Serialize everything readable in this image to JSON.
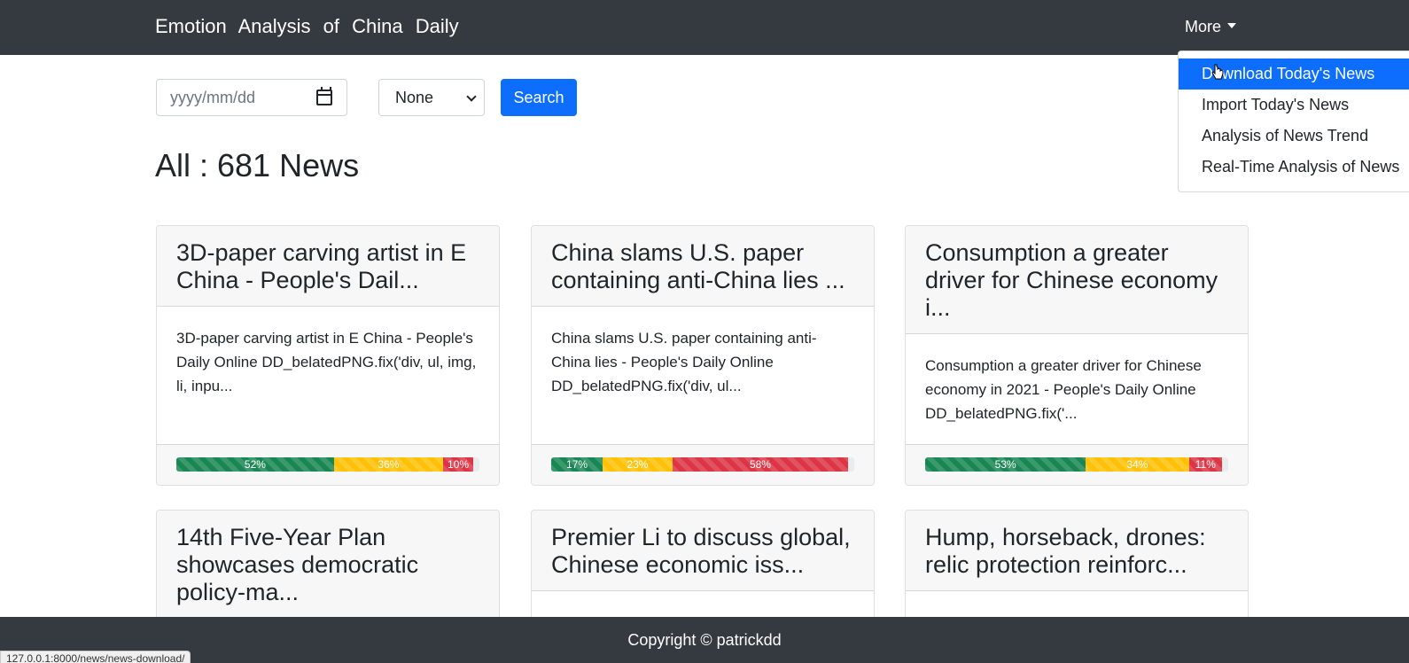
{
  "navbar": {
    "brand": "Emotion Analysis of China Daily",
    "more_label": "More",
    "dropdown_items": [
      "Download Today's News",
      "Import Today's News",
      "Analysis of News Trend",
      "Real-Time Analysis of News"
    ]
  },
  "search": {
    "date_placeholder": "yyyy/mm/dd",
    "select_value": "None",
    "button_label": "Search"
  },
  "heading": "All : 681 News",
  "cards": [
    {
      "title": "3D-paper carving artist in E China - People's Dail...",
      "body": "3D-paper carving artist in E China - People's Daily Online DD_belatedPNG.fix('div, ul, img, li, inpu...",
      "sentiment": {
        "positive": 52,
        "neutral": 36,
        "negative": 10
      },
      "labels": {
        "positive": "52%",
        "neutral": "36%",
        "negative": "10%"
      }
    },
    {
      "title": "China slams U.S. paper containing anti-China lies ...",
      "body": "China slams U.S. paper containing anti-China lies - People's Daily Online DD_belatedPNG.fix('div, ul...",
      "sentiment": {
        "positive": 17,
        "neutral": 23,
        "negative": 58
      },
      "labels": {
        "positive": "17%",
        "neutral": "23%",
        "negative": "58%"
      }
    },
    {
      "title": "Consumption a greater driver for Chinese economy i...",
      "body": "Consumption a greater driver for Chinese economy in 2021 - People's Daily Online DD_belatedPNG.fix('...",
      "sentiment": {
        "positive": 53,
        "neutral": 34,
        "negative": 11
      },
      "labels": {
        "positive": "53%",
        "neutral": "34%",
        "negative": "11%"
      }
    },
    {
      "title": "14th Five-Year Plan showcases democratic policy-ma..."
    },
    {
      "title": "Premier Li to discuss global, Chinese economic iss..."
    },
    {
      "title": "Hump, horseback, drones: relic protection reinforc..."
    }
  ],
  "footer": {
    "copyright": "Copyright © patrickdd"
  },
  "status_bar_url": "127.0.0.1:8000/news/news-download/",
  "colors": {
    "navbar": "#343a40",
    "primary": "#0d6efd",
    "positive": "#198754",
    "neutral": "#ffc107",
    "negative": "#dc3545"
  }
}
